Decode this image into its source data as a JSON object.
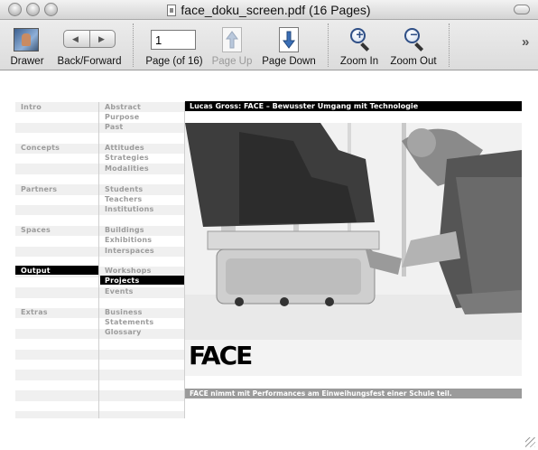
{
  "window": {
    "title": "face_doku_screen.pdf (16 Pages)"
  },
  "toolbar": {
    "drawer_label": "Drawer",
    "backforward_label": "Back/Forward",
    "page_value": "1",
    "page_label": "Page (of 16)",
    "page_up_label": "Page Up",
    "page_down_label": "Page Down",
    "zoom_in_label": "Zoom In",
    "zoom_out_label": "Zoom Out",
    "overflow_symbol": "»"
  },
  "document": {
    "heading": "Lucas Gross: FACE – Bewusster Umgang mit Technologie",
    "caption": "FACE nimmt mit Performances am Einweihungsfest einer Schule teil.",
    "photo_logo": "FACE",
    "nav_left": [
      "Intro",
      "Concepts",
      "Partners",
      "Spaces",
      "Output",
      "Extras"
    ],
    "nav_right": [
      [
        "Abstract",
        "Purpose",
        "Past"
      ],
      [
        "Attitudes",
        "Strategies",
        "Modalities"
      ],
      [
        "Students",
        "Teachers",
        "Institutions"
      ],
      [
        "Buildings",
        "Exhibitions",
        "Interspaces"
      ],
      [
        "Workshops",
        "Projects",
        "Events"
      ],
      [
        "Business",
        "Statements",
        "Glossary"
      ]
    ],
    "active_section": "Output",
    "active_item": "Projects"
  },
  "colors": {
    "active_bg": "#000000",
    "nav_text": "#9c9c9c",
    "caption_bg": "#9b9b9b"
  }
}
